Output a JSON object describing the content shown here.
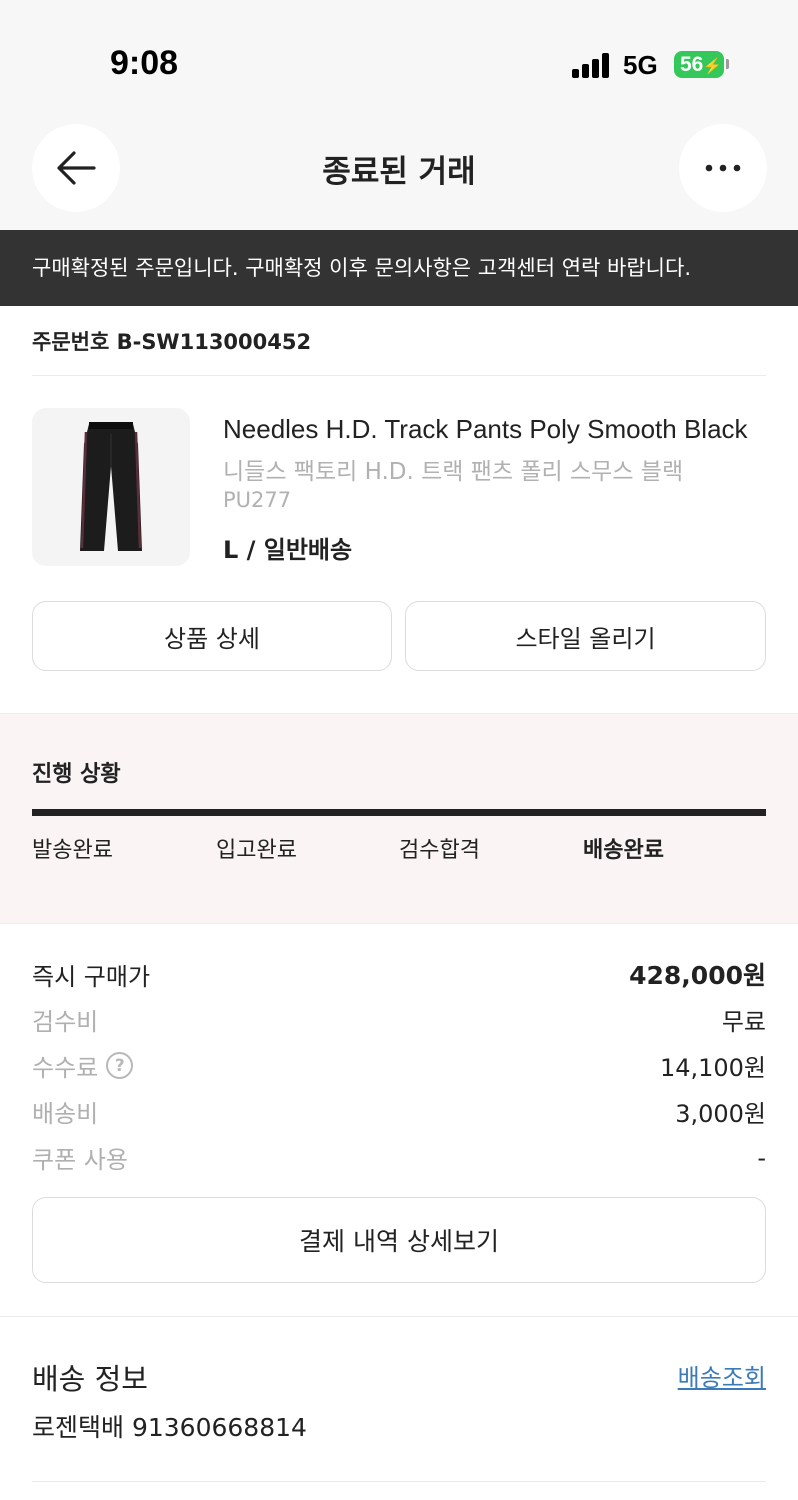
{
  "status_bar": {
    "time": "9:08",
    "network": "5G",
    "battery": "56"
  },
  "header": {
    "title": "종료된 거래"
  },
  "notice": {
    "text": "구매확정된 주문입니다. 구매확정 이후 문의사항은 고객센터 연락 바랍니다."
  },
  "order": {
    "number_label": "주문번호 B-SW113000452"
  },
  "product": {
    "name_en": "Needles H.D. Track Pants Poly Smooth Black",
    "name_ko": "니들스 팩토리 H.D. 트랙 팬츠 폴리 스무스 블랙",
    "code": "PU277",
    "option": "L / 일반배송",
    "buttons": {
      "detail": "상품 상세",
      "style": "스타일 올리기"
    }
  },
  "progress": {
    "title": "진행 상황",
    "steps": [
      "발송완료",
      "입고완료",
      "검수합격",
      "배송완료"
    ],
    "current_step": "배송완료"
  },
  "price": {
    "rows": [
      {
        "label": "즉시 구매가",
        "value": "428,000원"
      },
      {
        "label": "검수비",
        "value": "무료"
      },
      {
        "label": "수수료",
        "value": "14,100원"
      },
      {
        "label": "배송비",
        "value": "3,000원"
      },
      {
        "label": "쿠폰 사용",
        "value": "-"
      }
    ],
    "detail_button": "결제 내역 상세보기"
  },
  "shipping": {
    "title": "배송 정보",
    "link": "배송조회",
    "tracking": "로젠택배 91360668814"
  },
  "icons": {
    "back": "arrow-left-icon",
    "more": "more-horizontal-icon",
    "help": "question-circle-icon"
  },
  "colors": {
    "notice_bg": "#333333",
    "progress_bg": "#fbf4f4",
    "link": "#3b7bb8",
    "battery": "#34c759"
  }
}
